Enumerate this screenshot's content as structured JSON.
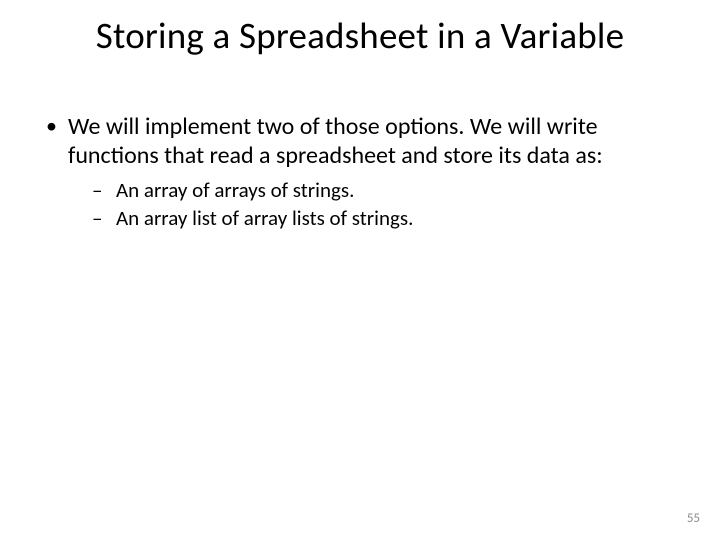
{
  "title": "Storing a Spreadsheet in a Variable",
  "bullets": [
    {
      "text": "We will implement two of those options. We will write functions that read a spreadsheet and store its data as:",
      "sub": [
        "An array of arrays of strings.",
        "An array list of array lists of strings."
      ]
    }
  ],
  "page_number": "55"
}
